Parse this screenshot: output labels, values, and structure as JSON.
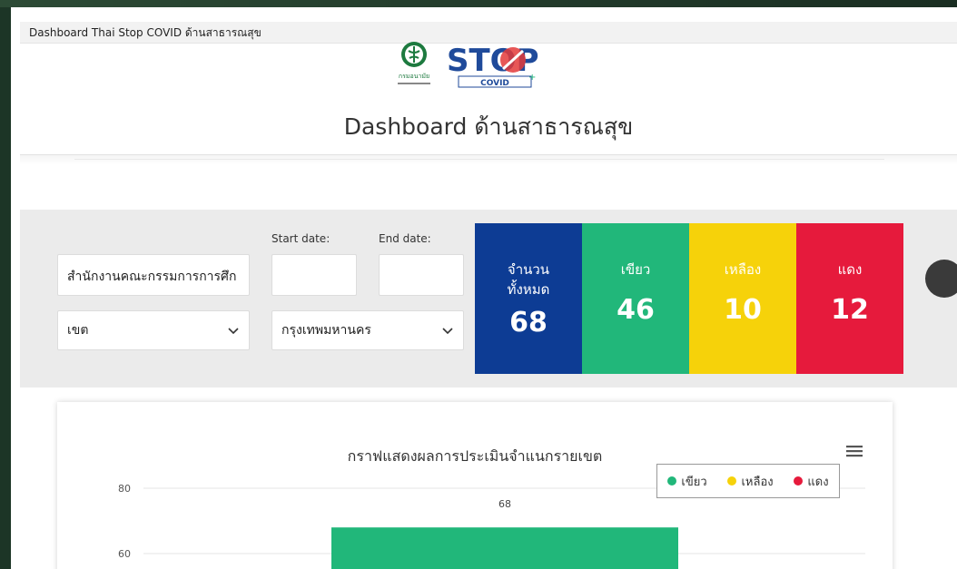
{
  "window": {
    "title": "Dashboard Thai Stop COVID ด้านสาธารณสุข"
  },
  "logos": {
    "stop_text": "STOP",
    "covid_text": "COVID",
    "dept_text": "กรมอนามัย"
  },
  "page_title": "Dashboard ด้านสาธารณสุข",
  "filters": {
    "agency_value": "สำนักงานคณะกรรมการการศึก",
    "start_date_label": "Start date:",
    "end_date_label": "End date:",
    "start_date_value": "",
    "end_date_value": "",
    "zone_value": "เขต",
    "province_value": "กรุงเทพมหานคร"
  },
  "stats": {
    "total_label_line1": "จำนวน",
    "total_label_line2": "ทั้งหมด",
    "total_value": "68",
    "green_label": "เขียว",
    "green_value": "46",
    "yellow_label": "เหลือง",
    "yellow_value": "10",
    "red_label": "แดง",
    "red_value": "12"
  },
  "colors": {
    "total": "#0d3c94",
    "green": "#21b77a",
    "yellow": "#f6d20a",
    "red": "#e61a3c"
  },
  "chart_data": {
    "type": "bar",
    "title": "กราฟแสดงผลการประเมินจำแนกรายเขต",
    "series": [
      {
        "name": "เขียว",
        "color": "#21b77a",
        "values": [
          68
        ]
      },
      {
        "name": "เหลือง",
        "color": "#f6d20a",
        "values": []
      },
      {
        "name": "แดง",
        "color": "#e61a3c",
        "values": []
      }
    ],
    "data_labels": [
      "68"
    ],
    "y_ticks": [
      "80",
      "60"
    ],
    "ylim": [
      60,
      80
    ],
    "grid": true,
    "legend": "top-right"
  }
}
